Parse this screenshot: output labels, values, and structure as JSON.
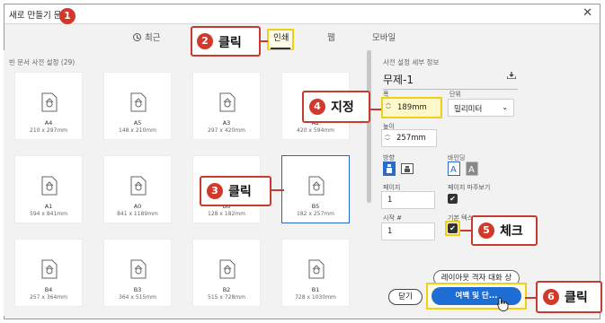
{
  "window": {
    "title": "새로 만들기 문서",
    "close_glyph": "✕"
  },
  "tabs": [
    {
      "label": "최근"
    },
    {
      "label": "인쇄"
    },
    {
      "label": "웹"
    },
    {
      "label": "모바일"
    }
  ],
  "presets_section": {
    "label": "빈 문서 사전 설정  (29)",
    "cards": [
      {
        "name": "A4",
        "dims": "210 x 297mm"
      },
      {
        "name": "A5",
        "dims": "148 x 210mm"
      },
      {
        "name": "A3",
        "dims": "297 x 420mm"
      },
      {
        "name": "A2",
        "dims": "420 x 594mm"
      },
      {
        "name": "A1",
        "dims": "594 x 841mm"
      },
      {
        "name": "A0",
        "dims": "841 x 1189mm"
      },
      {
        "name": "B6",
        "dims": "128 x 182mm"
      },
      {
        "name": "B5",
        "dims": "182 x 257mm"
      },
      {
        "name": "B4",
        "dims": "257 x 364mm"
      },
      {
        "name": "B3",
        "dims": "364 x 515mm"
      },
      {
        "name": "B2",
        "dims": "515 x 728mm"
      },
      {
        "name": "B1",
        "dims": "728 x 1030mm"
      }
    ]
  },
  "details": {
    "header": "사전 설정 세부 정보",
    "preset_name": "무제-1",
    "width_label": "폭",
    "width_value": "189mm",
    "unit_label": "단위",
    "unit_value": "밀리미터",
    "height_label": "높이",
    "height_value": "257mm",
    "orientation_label": "방향",
    "binding_label": "바인딩",
    "pages_label": "페이지",
    "pages_value": "1",
    "facing_label": "페이지 마주보기",
    "start_label": "시작 #",
    "start_value": "1",
    "primary_text_label": "기본 텍스",
    "check_glyph": "✔"
  },
  "buttons": {
    "layout": "레이아웃 격자 대화 상",
    "close": "닫기",
    "create": "여백 및 단..."
  },
  "callouts": [
    {
      "number": "1",
      "text": ""
    },
    {
      "number": "2",
      "text": "클릭"
    },
    {
      "number": "3",
      "text": "클릭"
    },
    {
      "number": "4",
      "text": "지정"
    },
    {
      "number": "5",
      "text": "체크"
    },
    {
      "number": "6",
      "text": "클릭"
    }
  ],
  "colors": {
    "accent_blue": "#1e6dd5",
    "callout_red": "#d13a2b",
    "highlight_yellow": "#f0cf1b"
  }
}
